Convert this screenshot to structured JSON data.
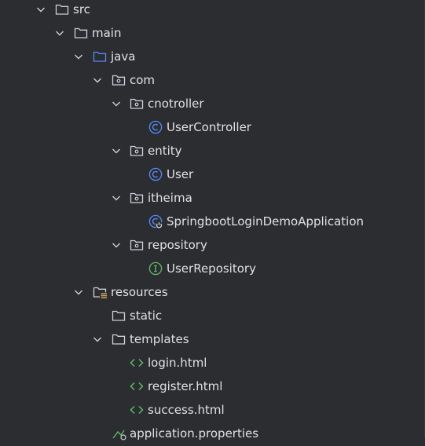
{
  "project_tree": {
    "items": [
      {
        "label": "src",
        "icon": "folder-icon",
        "expanded": true
      },
      {
        "label": "main",
        "icon": "folder-icon",
        "expanded": true
      },
      {
        "label": "java",
        "icon": "source-root-folder-icon",
        "expanded": true
      },
      {
        "label": "com",
        "icon": "package-icon",
        "expanded": true
      },
      {
        "label": "cnotroller",
        "icon": "package-icon",
        "expanded": true
      },
      {
        "label": "UserController",
        "icon": "class-icon"
      },
      {
        "label": "entity",
        "icon": "package-icon",
        "expanded": true
      },
      {
        "label": "User",
        "icon": "class-icon"
      },
      {
        "label": "itheima",
        "icon": "package-icon",
        "expanded": true
      },
      {
        "label": "SpringbootLoginDemoApplication",
        "icon": "spring-boot-application-icon"
      },
      {
        "label": "repository",
        "icon": "package-icon",
        "expanded": true
      },
      {
        "label": "UserRepository",
        "icon": "interface-icon"
      },
      {
        "label": "resources",
        "icon": "resources-folder-icon",
        "expanded": true
      },
      {
        "label": "static",
        "icon": "folder-icon"
      },
      {
        "label": "templates",
        "icon": "folder-icon",
        "expanded": true
      },
      {
        "label": "login.html",
        "icon": "html-file-icon"
      },
      {
        "label": "register.html",
        "icon": "html-file-icon"
      },
      {
        "label": "success.html",
        "icon": "html-file-icon"
      },
      {
        "label": "application.properties",
        "icon": "properties-file-icon"
      }
    ]
  },
  "colors": {
    "background": "#2b2d30",
    "text": "#dfe1e5",
    "icon_gray": "#ced0d6",
    "source_root_blue": "#548af7",
    "class_blue": "#548af7",
    "interface_green": "#5fb865",
    "html_green": "#5fb865",
    "resources_yellow": "#d6ae58"
  }
}
